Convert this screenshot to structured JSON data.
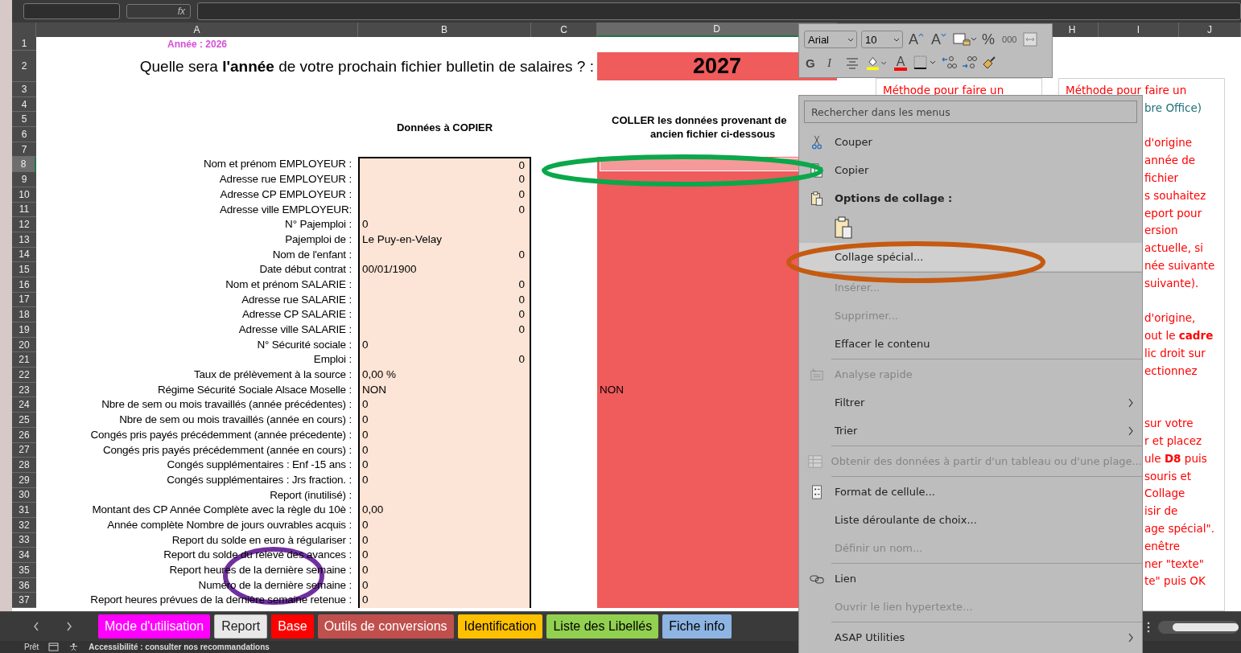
{
  "formula_bar": {
    "function_label": "fx"
  },
  "sheet": {
    "columns": [
      {
        "letter": "A",
        "selected": false
      },
      {
        "letter": "B",
        "selected": false
      },
      {
        "letter": "C",
        "selected": false
      },
      {
        "letter": "D",
        "selected": true
      },
      {
        "letter": "H",
        "selected": false
      },
      {
        "letter": "I",
        "selected": false
      },
      {
        "letter": "J",
        "selected": false
      }
    ],
    "headings": {
      "copy": "Données à COPIER",
      "paste_lines": [
        "COLLER les données provenant de",
        "ancien fichier ci-dessous"
      ]
    },
    "rows": [
      {
        "number": "1",
        "selected": false,
        "note": "Année : 2026"
      },
      {
        "number": "2",
        "selected": false,
        "question": "Quelle sera **l'année** de votre prochain fichier  bulletin de salaires ? :",
        "answer": "2027"
      },
      {
        "number": "3",
        "selected": false
      },
      {
        "number": "4",
        "selected": false
      },
      {
        "number": "5",
        "selected": false
      },
      {
        "number": "6",
        "selected": false
      },
      {
        "number": "7",
        "selected": false
      },
      {
        "number": "8",
        "selected": true,
        "label": "Nom et prénom EMPLOYEUR :",
        "value": "0",
        "kind": "number"
      },
      {
        "number": "9",
        "selected": false,
        "label": "Adresse rue EMPLOYEUR :",
        "value": "0",
        "kind": "number"
      },
      {
        "number": "10",
        "selected": false,
        "label": "Adresse CP EMPLOYEUR :",
        "value": "0",
        "kind": "number"
      },
      {
        "number": "11",
        "selected": false,
        "label": "Adresse ville EMPLOYEUR:",
        "value": "0",
        "kind": "number"
      },
      {
        "number": "12",
        "selected": false,
        "label": "N° Pajemploi :",
        "value": "0",
        "kind": "text"
      },
      {
        "number": "13",
        "selected": false,
        "label": "Pajemploi de :",
        "value": "Le Puy-en-Velay",
        "kind": "text"
      },
      {
        "number": "14",
        "selected": false,
        "label": "Nom de l'enfant :",
        "value": "0",
        "kind": "number"
      },
      {
        "number": "15",
        "selected": false,
        "label": "Date début contrat :",
        "value": "00/01/1900",
        "kind": "text"
      },
      {
        "number": "16",
        "selected": false,
        "label": "Nom et prénom SALARIE :",
        "value": "0",
        "kind": "number"
      },
      {
        "number": "17",
        "selected": false,
        "label": "Adresse rue SALARIE :",
        "value": "0",
        "kind": "number"
      },
      {
        "number": "18",
        "selected": false,
        "label": "Adresse CP SALARIE :",
        "value": "0",
        "kind": "number"
      },
      {
        "number": "19",
        "selected": false,
        "label": "Adresse ville SALARIE :",
        "value": "0",
        "kind": "number"
      },
      {
        "number": "20",
        "selected": false,
        "label": "N° Sécurité sociale :",
        "value": "0",
        "kind": "text"
      },
      {
        "number": "21",
        "selected": false,
        "label": "Emploi :",
        "value": "0",
        "kind": "number"
      },
      {
        "number": "22",
        "selected": false,
        "label": "Taux de prélèvement à la source :",
        "value": "0,00 %",
        "kind": "text"
      },
      {
        "number": "23",
        "selected": false,
        "label": "Régime Sécurité Sociale Alsace Moselle :",
        "value": "NON",
        "kind": "text",
        "pasted": "NON"
      },
      {
        "number": "24",
        "selected": false,
        "label": "Nbre de sem ou mois travaillés (année précédentes) :",
        "value": "0",
        "kind": "text"
      },
      {
        "number": "25",
        "selected": false,
        "label": "Nbre de sem ou mois travaillés (année en cours) :",
        "value": "0",
        "kind": "text"
      },
      {
        "number": "26",
        "selected": false,
        "label": "Congés pris payés précédemment (année précedente) :",
        "value": "0",
        "kind": "text"
      },
      {
        "number": "27",
        "selected": false,
        "label": "Congés pris payés précédemment (année en cours) :",
        "value": "0",
        "kind": "text"
      },
      {
        "number": "28",
        "selected": false,
        "label": "Congés supplémentaires : Enf -15 ans :",
        "value": "0",
        "kind": "text"
      },
      {
        "number": "29",
        "selected": false,
        "label": "Congés supplémentaires : Jrs fraction. :",
        "value": "0",
        "kind": "text"
      },
      {
        "number": "30",
        "selected": false,
        "label": "Report (inutilisé) :"
      },
      {
        "number": "31",
        "selected": false,
        "label": "Montant des CP Année Complète avec la règle du 10è :",
        "value": "0,00",
        "kind": "text"
      },
      {
        "number": "32",
        "selected": false,
        "label": "Année complète Nombre de jours ouvrables acquis :",
        "value": "0",
        "kind": "text"
      },
      {
        "number": "33",
        "selected": false,
        "label": "Report du solde en euro à régulariser  :",
        "value": "0",
        "kind": "text"
      },
      {
        "number": "34",
        "selected": false,
        "label": "Report du solde du relevé des avances  :",
        "value": "0",
        "kind": "text"
      },
      {
        "number": "35",
        "selected": false,
        "label": "Report heures de la dernière semaine :",
        "value": "0",
        "kind": "text"
      },
      {
        "number": "36",
        "selected": false,
        "label": "Numéro de la dernière semaine :",
        "value": "0",
        "kind": "text"
      },
      {
        "number": "37",
        "selected": false,
        "label": "Report heures prévues de la dernière semaine retenue :",
        "value": "0",
        "kind": "text"
      }
    ]
  },
  "text_boxes": [
    {
      "lines": [
        {
          "kind": "full",
          "text": "Méthode pour faire un"
        }
      ]
    },
    {
      "lines": [
        {
          "kind": "full",
          "text": "Méthode pour faire un"
        },
        {
          "kind": "clipped",
          "text": "bre Office)",
          "color": "#1f6f7a"
        },
        {
          "kind": "blank"
        },
        {
          "kind": "clipped",
          "text": "d'origine"
        },
        {
          "kind": "clipped",
          "text": "année de"
        },
        {
          "kind": "clipped",
          "text": "fichier"
        },
        {
          "kind": "clipped",
          "text": "s souhaitez"
        },
        {
          "kind": "clipped",
          "text": "eport pour"
        },
        {
          "kind": "clipped",
          "text": "ersion"
        },
        {
          "kind": "clipped",
          "text": "actuelle, si"
        },
        {
          "kind": "clipped",
          "text": "née suivante"
        },
        {
          "kind": "clipped",
          "text": "suivante)."
        },
        {
          "kind": "blank"
        },
        {
          "kind": "clipped",
          "text": "d'origine,"
        },
        {
          "kind": "clipped",
          "text": "out le **cadre**"
        },
        {
          "kind": "clipped",
          "text": "lic droit sur"
        },
        {
          "kind": "clipped",
          "text": "ectionnez"
        },
        {
          "kind": "blank"
        },
        {
          "kind": "blank"
        },
        {
          "kind": "clipped",
          "text": "sur votre"
        },
        {
          "kind": "clipped",
          "text": "r et placez"
        },
        {
          "kind": "clipped",
          "text": "ule **D8** puis"
        },
        {
          "kind": "clipped",
          "text": "souris et"
        },
        {
          "kind": "clipped",
          "text": "Collage"
        },
        {
          "kind": "clipped",
          "text": "isir de"
        },
        {
          "kind": "clipped",
          "text": "age spécial\"."
        },
        {
          "kind": "clipped",
          "text": "enêtre"
        },
        {
          "kind": "clipped",
          "text": "ner \"texte\""
        },
        {
          "kind": "clipped",
          "text": "te\" puis OK"
        }
      ]
    }
  ],
  "mini_toolbar": {
    "rows": [
      [
        {
          "kind": "select",
          "value": "Arial"
        },
        {
          "kind": "select",
          "value": "10"
        },
        {
          "kind": "grow-font",
          "label": "A"
        },
        {
          "kind": "shrink-font",
          "label": "A"
        },
        {
          "kind": "number-format"
        },
        {
          "kind": "percent",
          "label": "%"
        },
        {
          "kind": "thousands",
          "label": "000"
        },
        {
          "kind": "merge"
        }
      ],
      [
        {
          "kind": "bold",
          "label": "G"
        },
        {
          "kind": "italic",
          "label": "I"
        },
        {
          "kind": "align"
        },
        {
          "kind": "fill-color",
          "color": "#ffff00"
        },
        {
          "kind": "font-color",
          "label": "A",
          "color": "#ff0000"
        },
        {
          "kind": "borders"
        },
        {
          "kind": "decimal-increase"
        },
        {
          "kind": "decimal-decrease"
        },
        {
          "kind": "format-painter"
        }
      ]
    ]
  },
  "context_menu": {
    "search": {
      "placeholder": "Rechercher dans les menus"
    },
    "items": [
      {
        "kind": "cut",
        "label": "Couper",
        "disabled": false,
        "selected": false
      },
      {
        "kind": "copy",
        "label": "Copier",
        "disabled": false,
        "selected": false
      },
      {
        "kind": "paste-header",
        "label": "Options de collage :",
        "disabled": false,
        "selected": false
      },
      {
        "kind": "paste-button",
        "disabled": false,
        "selected": false
      },
      {
        "kind": "command",
        "label": "Collage spécial...",
        "disabled": false,
        "selected": true
      },
      {
        "kind": "separator"
      },
      {
        "kind": "command",
        "label": "Insérer...",
        "disabled": true,
        "selected": false
      },
      {
        "kind": "command",
        "label": "Supprimer...",
        "disabled": true,
        "selected": false
      },
      {
        "kind": "command",
        "label": "Effacer le contenu",
        "disabled": false,
        "selected": false
      },
      {
        "kind": "separator"
      },
      {
        "kind": "quick-analysis",
        "label": "Analyse rapide",
        "disabled": true,
        "selected": false
      },
      {
        "kind": "submenu",
        "label": "Filtrer",
        "disabled": false,
        "selected": false
      },
      {
        "kind": "submenu",
        "label": "Trier",
        "disabled": false,
        "selected": false
      },
      {
        "kind": "separator"
      },
      {
        "kind": "get-data",
        "label": "Obtenir des données à partir d'un tableau ou d'une plage...",
        "disabled": true,
        "selected": false
      },
      {
        "kind": "separator"
      },
      {
        "kind": "format-cells",
        "label": "Format de cellule...",
        "disabled": false,
        "selected": false
      },
      {
        "kind": "command",
        "label": "Liste déroulante de choix...",
        "disabled": false,
        "selected": false
      },
      {
        "kind": "command",
        "label": "Définir un nom...",
        "disabled": true,
        "selected": false
      },
      {
        "kind": "separator"
      },
      {
        "kind": "link",
        "label": "Lien",
        "disabled": false,
        "selected": false
      },
      {
        "kind": "command",
        "label": "Ouvrir le lien hypertexte...",
        "disabled": true,
        "selected": false
      },
      {
        "kind": "separator"
      },
      {
        "kind": "submenu",
        "label": "ASAP Utilities",
        "disabled": false,
        "selected": false
      }
    ]
  },
  "sheet_tabs": [
    {
      "label": "Mode d'utilisation",
      "color": "#ff00ff",
      "selected": false
    },
    {
      "label": "Report",
      "selected": true
    },
    {
      "label": "Base",
      "color": "#ff0000",
      "selected": false
    },
    {
      "label": "Outils de conversions",
      "color": "#c0504d",
      "selected": false
    },
    {
      "label": "Identification",
      "color": "#ffc000",
      "selected": false
    },
    {
      "label": "Liste des Libellés",
      "color": "#92d050",
      "selected": false
    },
    {
      "label": "Fiche info",
      "color": "#8db4e2",
      "selected": false
    }
  ],
  "annotations": [
    {
      "color": "#0aa84a"
    },
    {
      "color": "#c55a11"
    },
    {
      "color": "#7030a0"
    }
  ],
  "status_bar": {
    "mode": "Prêt",
    "accessibility": "Accessibilité : consulter nos recommandations"
  }
}
